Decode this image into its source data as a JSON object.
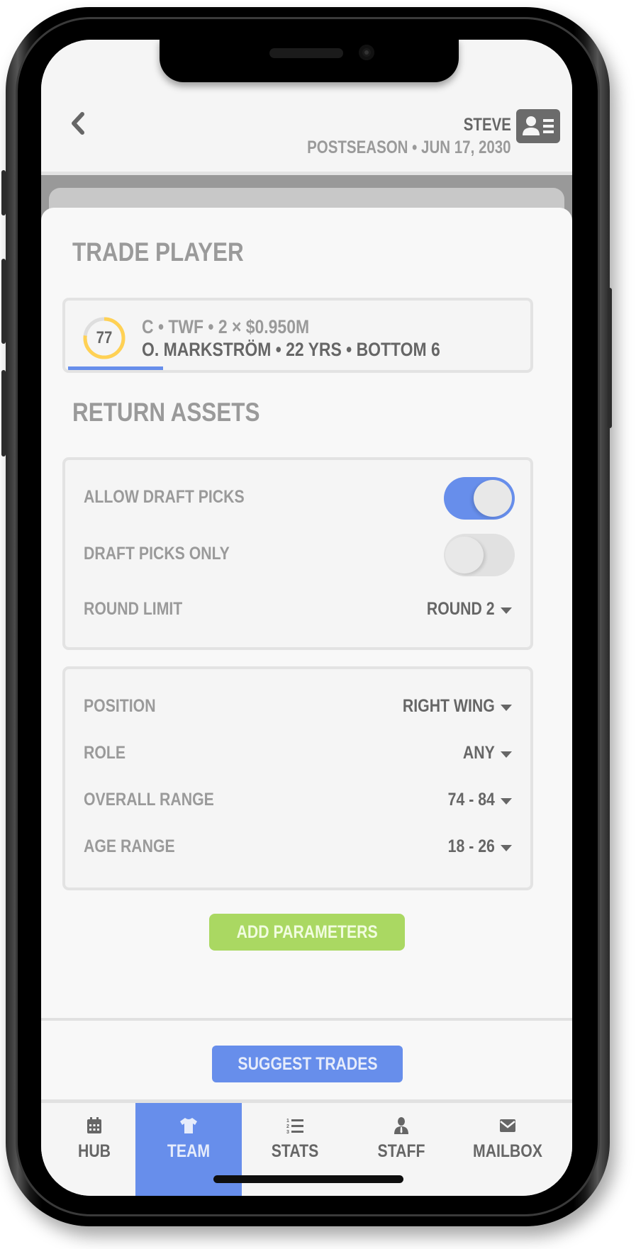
{
  "header": {
    "back_label": "back",
    "user_name": "STEVE",
    "season_line": "POSTSEASON •  JUN 17, 2030",
    "profile_icon": "id-card-icon"
  },
  "trade_player": {
    "title": "TRADE PLAYER",
    "rating": "77",
    "rating_fraction": 0.77,
    "rating_color": "#ffd154",
    "meta": "C • TWF • 2 × $0.950M",
    "name_line": "O. MARKSTRÖM • 22 YRS • BOTTOM 6",
    "progress_fraction": 0.205
  },
  "return_assets": {
    "title": "RETURN ASSETS",
    "allow_draft_picks": {
      "label": "ALLOW DRAFT PICKS",
      "on": true
    },
    "draft_picks_only": {
      "label": "DRAFT PICKS ONLY",
      "on": false
    },
    "round_limit": {
      "label": "ROUND LIMIT",
      "value": "ROUND 2"
    }
  },
  "filters": [
    {
      "label": "POSITION",
      "value": "RIGHT WING"
    },
    {
      "label": "ROLE",
      "value": "ANY"
    },
    {
      "label": "OVERALL RANGE",
      "value": "74 - 84"
    },
    {
      "label": "AGE RANGE",
      "value": "18 - 26"
    }
  ],
  "buttons": {
    "add_parameters": "ADD PARAMETERS",
    "suggest_trades": "SUGGEST TRADES"
  },
  "tabs": [
    {
      "label": "HUB",
      "icon": "calendar-icon",
      "active": false
    },
    {
      "label": "TEAM",
      "icon": "jersey-icon",
      "active": true
    },
    {
      "label": "STATS",
      "icon": "numbered-list-icon",
      "active": false
    },
    {
      "label": "STAFF",
      "icon": "staff-person-icon",
      "active": false
    },
    {
      "label": "MAILBOX",
      "icon": "envelope-icon",
      "active": false
    }
  ],
  "colors": {
    "accent_blue": "#678eeb",
    "accent_green": "#aad862",
    "rating_yellow": "#ffd154",
    "text_dark": "#666666",
    "text_muted": "#9a9a9a"
  }
}
